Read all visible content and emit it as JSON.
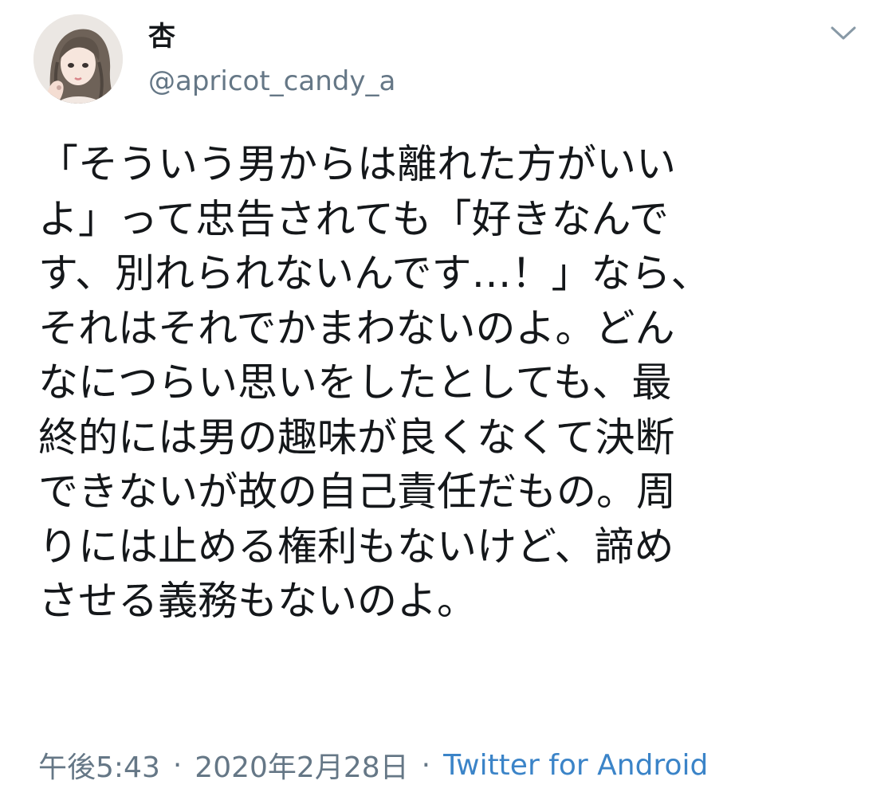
{
  "tweet": {
    "author": {
      "display_name": "杏",
      "handle": "@apricot_candy_a",
      "avatar_icon": "avatar-illustration"
    },
    "menu_icon": "chevron-down-icon",
    "text": "「そういう男からは離れた方がいい\nよ」って忠告されても「好きなんで\nす、別れられないんです…！」なら、\nそれはそれでかまわないのよ。どん\nなにつらい思いをしたとしても、最\n終的には男の趣味が良くなくて決断\nできないが故の自己責任だもの。周\nりには止める権利もないけど、諦め\nさせる義務もないのよ。",
    "time": "午後5:43",
    "date": "2020年2月28日",
    "separator": "·",
    "source": "Twitter for Android"
  },
  "colors": {
    "text": "#14171a",
    "secondary": "#657786",
    "link": "#3b84c8",
    "background": "#ffffff"
  }
}
